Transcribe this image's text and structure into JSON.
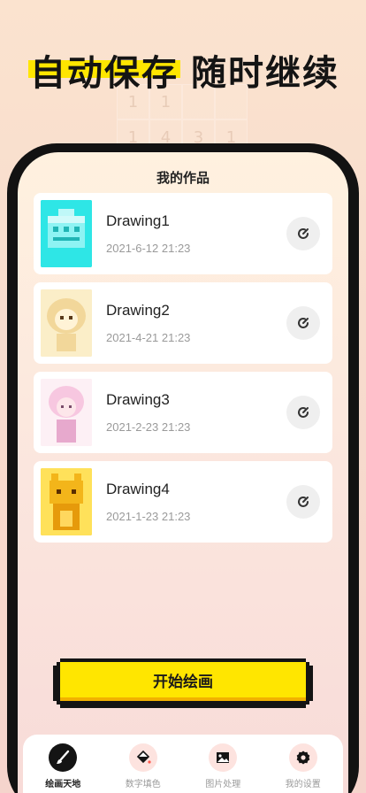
{
  "headline": {
    "left": "自动保存",
    "right": "随时继续"
  },
  "bg_numbers": [
    "1",
    "1",
    "",
    "",
    "1",
    "4",
    "3",
    "1"
  ],
  "screen": {
    "title": "我的作品"
  },
  "works": [
    {
      "name": "Drawing1",
      "date": "2021-6-12 21:23",
      "thumb_color": "#2ee6e6"
    },
    {
      "name": "Drawing2",
      "date": "2021-4-21 21:23",
      "thumb_color": "#f6e3b0"
    },
    {
      "name": "Drawing3",
      "date": "2021-2-23 21:23",
      "thumb_color": "#f7c7e0"
    },
    {
      "name": "Drawing4",
      "date": "2021-1-23 21:23",
      "thumb_color": "#f3b51a"
    }
  ],
  "start_button": {
    "label": "开始绘画"
  },
  "tabs": [
    {
      "label": "绘画天地",
      "icon": "brush-icon",
      "active": true
    },
    {
      "label": "数字填色",
      "icon": "paint-bucket-icon",
      "active": false
    },
    {
      "label": "图片处理",
      "icon": "image-icon",
      "active": false
    },
    {
      "label": "我的设置",
      "icon": "gear-icon",
      "active": false
    }
  ],
  "colors": {
    "accent": "#ffe600",
    "frame": "#121212"
  }
}
